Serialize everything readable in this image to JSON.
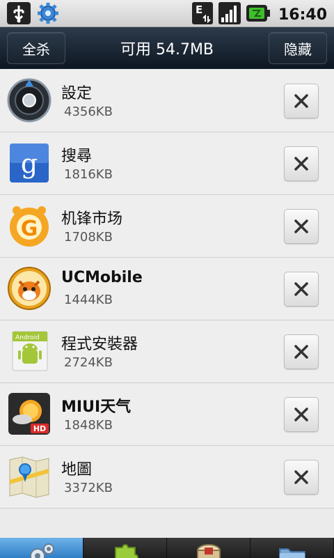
{
  "status_bar": {
    "time": "16:40",
    "network_type": "E",
    "icons": [
      "usb-icon",
      "settings-gear-icon",
      "network-edge-icon",
      "signal-strength-icon",
      "battery-icon"
    ]
  },
  "header": {
    "left_button": "全杀",
    "title": "可用 54.7MB",
    "right_button": "隐藏"
  },
  "apps": [
    {
      "name": "設定",
      "size": "4356KB",
      "icon": "settings-app-icon"
    },
    {
      "name": "搜尋",
      "size": "1816KB",
      "icon": "google-search-icon"
    },
    {
      "name": "机锋市场",
      "size": "1708KB",
      "icon": "gfan-market-icon"
    },
    {
      "name": "UCMobile",
      "size": "1444KB",
      "icon": "ucmobile-icon"
    },
    {
      "name": "程式安裝器",
      "size": "2724KB",
      "icon": "package-installer-icon"
    },
    {
      "name": "MIUI天气",
      "size": "1848KB",
      "icon": "miui-weather-icon"
    },
    {
      "name": "地圖",
      "size": "3372KB",
      "icon": "maps-icon"
    }
  ],
  "bottom_tabs": [
    {
      "icon": "gears-icon",
      "active": true
    },
    {
      "icon": "puzzle-icon",
      "active": false
    },
    {
      "icon": "box-icon",
      "active": false
    },
    {
      "icon": "folder-icon",
      "active": false
    }
  ],
  "colors": {
    "header_bg": "#1a2533",
    "active_tab": "#4a98d8",
    "list_bg": "#eeeeee"
  }
}
